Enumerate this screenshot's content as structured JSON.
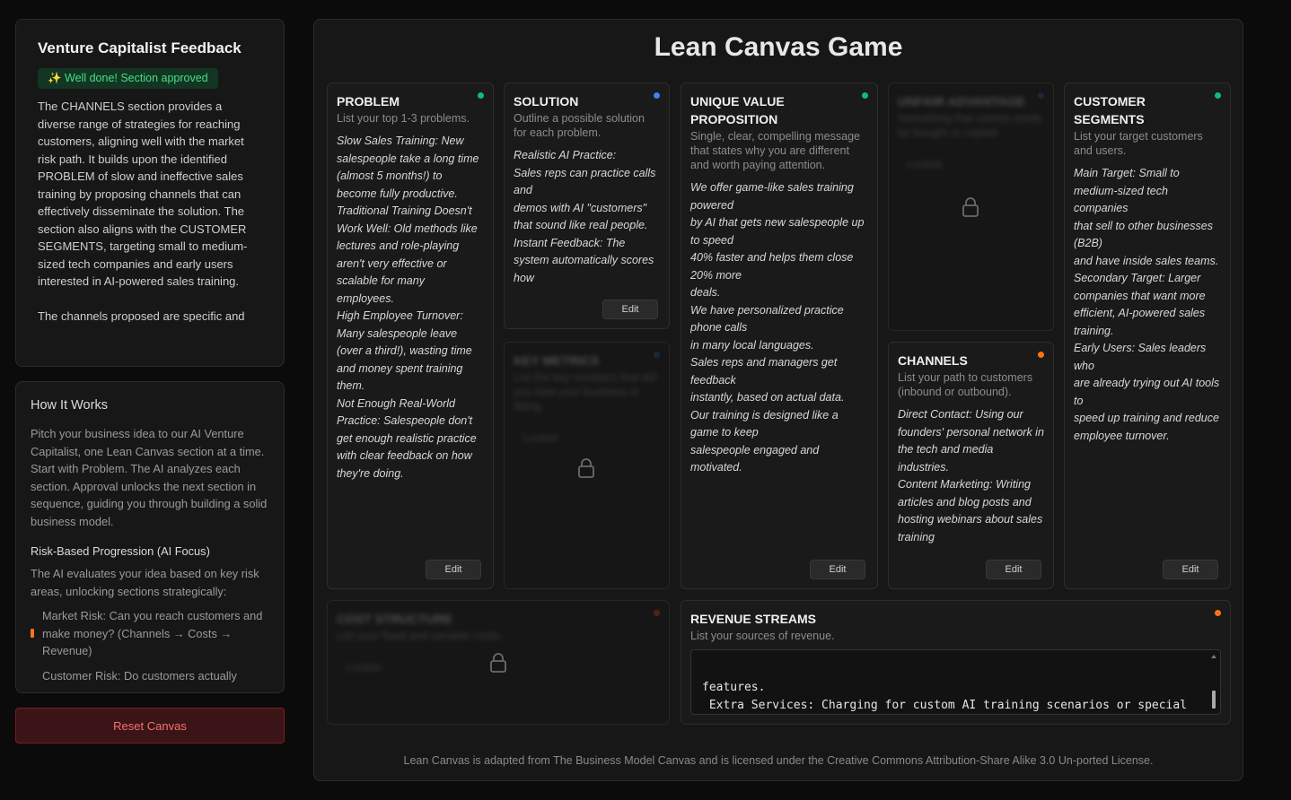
{
  "feedback": {
    "title": "Venture Capitalist Feedback",
    "badge": "✨ Well done! Section approved",
    "text": "The CHANNELS section provides a diverse range of strategies for reaching customers, aligning well with the market risk path. It builds upon the identified PROBLEM of slow and ineffective sales training by proposing channels that can effectively disseminate the solution. The section also aligns with the CUSTOMER SEGMENTS, targeting small to medium-sized tech companies and early users interested in AI-powered sales training.\n\nThe channels proposed are specific and actionable, demonstrating a deep"
  },
  "how": {
    "title": "How It Works",
    "intro": "Pitch your business idea to our AI Venture Capitalist, one Lean Canvas section at a time. Start with Problem. The AI analyzes each section. Approval unlocks the next section in sequence, guiding you through building a solid business model.",
    "risk_title": "Risk-Based Progression (AI Focus)",
    "risk_intro": "The AI evaluates your idea based on key risk areas, unlocking sections strategically:",
    "risk_items": [
      "Market Risk: Can you reach customers and make money? (Channels → Costs → Revenue)",
      "Customer Risk: Do customers actually"
    ],
    "reset": "Reset Canvas"
  },
  "main": {
    "title": "Lean Canvas Game",
    "footer": "Lean Canvas is adapted from The Business Model Canvas and is licensed under the Creative Commons Attribution-Share Alike 3.0 Un-ported License.",
    "edit_label": "Edit",
    "locked_label": "Locked"
  },
  "colors": {
    "green": "#10b981",
    "blue": "#3b82f6",
    "orange": "#f97316"
  },
  "sections": {
    "problem": {
      "title": "PROBLEM",
      "sub": "List your top 1-3 problems.",
      "status": "approved",
      "content": "Slow Sales Training: New salespeople take a long time (almost 5 months!) to become fully productive.\nTraditional Training Doesn't Work Well: Old methods like lectures and role-playing aren't very effective or scalable for many employees.\nHigh Employee Turnover: Many salespeople leave (over a third!), wasting time and money spent training them.\nNot Enough Real-World Practice: Salespeople don't get enough realistic practice with clear feedback on how they're doing."
    },
    "solution": {
      "title": "SOLUTION",
      "sub": "Outline a possible solution for each problem.",
      "status": "pending",
      "content": "Realistic AI Practice:\nSales reps can practice calls and\ndemos with AI \"customers\" that sound like real people.\nInstant Feedback: The system automatically scores how"
    },
    "uvp": {
      "title": "UNIQUE VALUE PROPOSITION",
      "sub": "Single, clear, compelling message that states why you are different and worth paying attention.",
      "status": "approved",
      "content": "We offer game-like sales training powered\nby AI that gets new salespeople up to speed\n40% faster and helps them close 20% more\ndeals.\nWe have personalized practice phone calls\nin many local languages.\nSales reps and managers get feedback\ninstantly, based on actual data.\nOur training is designed like a game to keep\nsalespeople engaged and motivated."
    },
    "unfair": {
      "title": "UNFAIR ADVANTAGE",
      "sub": "Something that cannot easily be bought or copied.",
      "status": "locked"
    },
    "segments": {
      "title": "CUSTOMER SEGMENTS",
      "sub": "List your target customers and users.",
      "status": "approved",
      "content": "Main Target: Small to medium-sized tech companies\nthat sell to other businesses (B2B)\nand have inside sales teams.\nSecondary Target: Larger companies that want more\nefficient, AI-powered sales\ntraining.\nEarly Users: Sales leaders who\nare already trying out AI tools to\nspeed up training and reduce\nemployee turnover."
    },
    "metrics": {
      "title": "KEY METRICS",
      "sub": "List the key numbers that tell you how your business is doing.",
      "status": "locked"
    },
    "channels": {
      "title": "CHANNELS",
      "sub": "List your path to customers (inbound or outbound).",
      "status": "review",
      "content": "Direct Contact: Using our founders' personal network in the tech and media industries.\nContent Marketing: Writing articles and blog posts and hosting webinars about sales training"
    },
    "cost": {
      "title": "COST STRUCTURE",
      "sub": "List your fixed and variable costs.",
      "status": "locked"
    },
    "revenue": {
      "title": "REVENUE STREAMS",
      "sub": "List your sources of revenue.",
      "status": "review",
      "content": "features.\n Extra Services: Charging for custom AI training scenarios or special training modules."
    }
  }
}
